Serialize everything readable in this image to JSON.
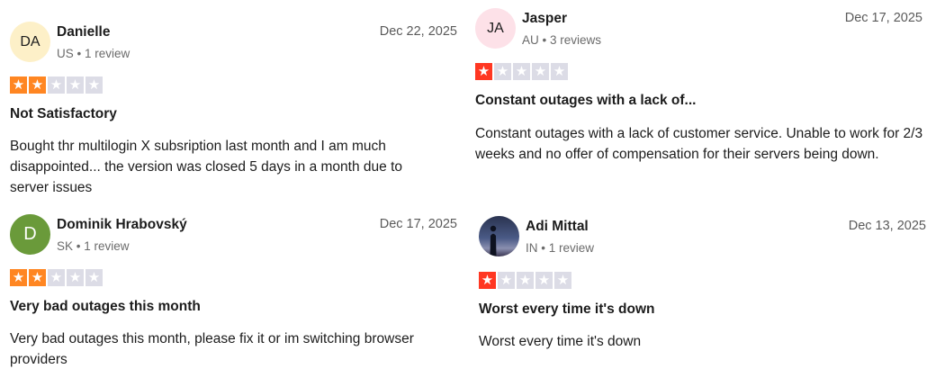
{
  "colors": {
    "star_two": "#ff8622",
    "star_one": "#ff3722",
    "star_empty": "#dcdce6"
  },
  "reviews": [
    {
      "initials": "DA",
      "name": "Danielle",
      "meta": "US • 1 review",
      "date": "Dec 22, 2025",
      "rating": 2,
      "title": "Not Satisfactory",
      "body": "Bought thr multilogin X subsription last month and I am much disappointed... the version was closed 5 days in a month due to server issues",
      "avatar_color": "#fdf0c8"
    },
    {
      "initials": "JA",
      "name": "Jasper",
      "meta": "AU • 3 reviews",
      "date": "Dec 17, 2025",
      "rating": 1,
      "title": "Constant outages with a lack of...",
      "body": "Constant outages with a lack of customer service. Unable to work for 2/3 weeks and no offer of compensation for their servers being down.",
      "avatar_color": "#fde1e8"
    },
    {
      "initials": "D",
      "name": "Dominik Hrabovský",
      "meta": "SK • 1 review",
      "date": "Dec 17, 2025",
      "rating": 2,
      "title": "Very bad outages this month",
      "body": "Very bad outages this month, please fix it or im switching browser providers",
      "avatar_color": "#6a9a3a"
    },
    {
      "initials": "",
      "name": "Adi Mittal",
      "meta": "IN • 1 review",
      "date": "Dec 13, 2025",
      "rating": 1,
      "title": "Worst every time it's down",
      "body": "Worst every time it's down",
      "avatar_color": "#3a4468"
    }
  ]
}
